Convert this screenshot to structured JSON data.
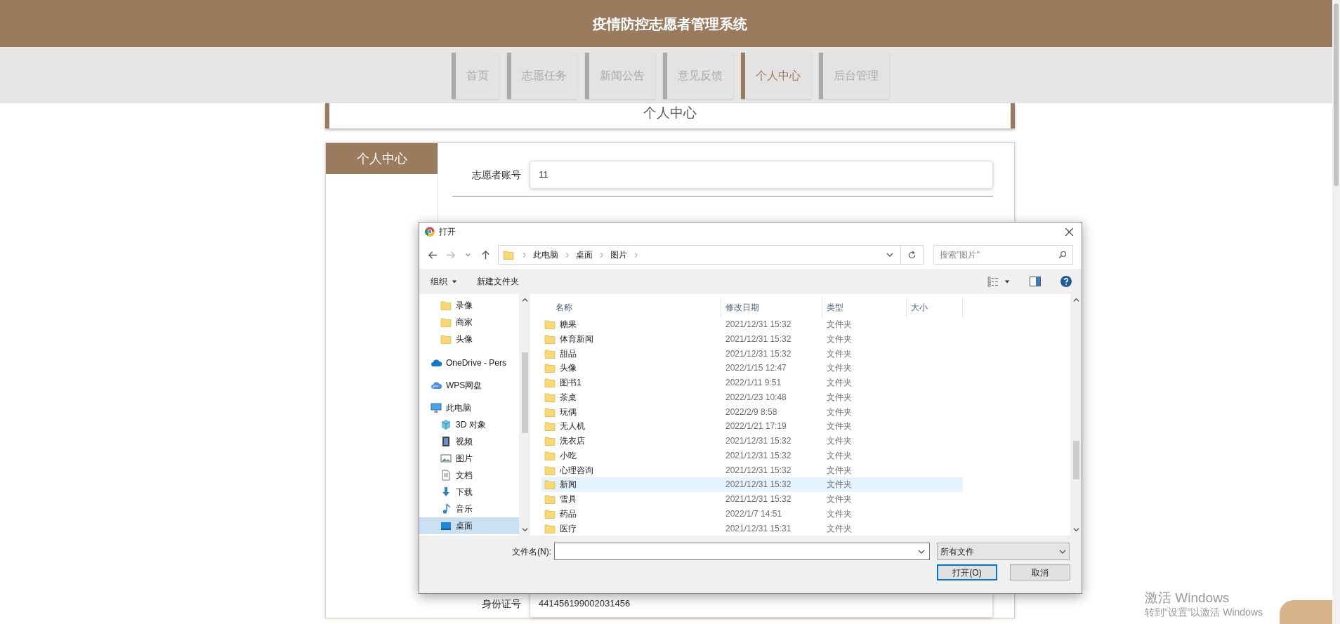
{
  "header": {
    "title": "疫情防控志愿者管理系统"
  },
  "nav": [
    {
      "label": "首页",
      "selected": false
    },
    {
      "label": "志愿任务",
      "selected": false
    },
    {
      "label": "新闻公告",
      "selected": false
    },
    {
      "label": "意见反馈",
      "selected": false
    },
    {
      "label": "个人中心",
      "selected": true
    },
    {
      "label": "后台管理",
      "selected": false
    }
  ],
  "page_title": "个人中心",
  "sidebar": {
    "title": "个人中心"
  },
  "form": {
    "fields": [
      {
        "label": "志愿者账号",
        "value": "11"
      },
      {
        "label": "身份证号",
        "value": "441456199002031456"
      }
    ]
  },
  "dialog": {
    "title": "打开",
    "breadcrumb": [
      "此电脑",
      "桌面",
      "图片"
    ],
    "search": {
      "placeholder": "搜索\"图片\""
    },
    "toolbar": {
      "organize": "组织",
      "new_folder": "新建文件夹"
    },
    "nav_pane": [
      {
        "label": "录像",
        "kind": "folder",
        "selected": false
      },
      {
        "label": "商家",
        "kind": "folder",
        "selected": false
      },
      {
        "label": "头像",
        "kind": "folder",
        "selected": false
      },
      {
        "label": "OneDrive - Pers",
        "kind": "onedrive",
        "selected": false
      },
      {
        "label": "WPS网盘",
        "kind": "cloud",
        "selected": false
      },
      {
        "label": "此电脑",
        "kind": "pc",
        "selected": false,
        "children": [
          {
            "label": "3D 对象",
            "kind": "cube",
            "selected": false
          },
          {
            "label": "视频",
            "kind": "video",
            "selected": false
          },
          {
            "label": "图片",
            "kind": "pictures",
            "selected": false
          },
          {
            "label": "文档",
            "kind": "document",
            "selected": false
          },
          {
            "label": "下载",
            "kind": "download",
            "selected": false
          },
          {
            "label": "音乐",
            "kind": "music",
            "selected": false
          },
          {
            "label": "桌面",
            "kind": "desktop",
            "selected": true
          }
        ]
      }
    ],
    "columns": [
      "名称",
      "修改日期",
      "类型",
      "大小"
    ],
    "files": [
      {
        "name": "糖果",
        "modified": "2021/12/31 15:32",
        "type": "文件夹",
        "hovered": false
      },
      {
        "name": "体育新闻",
        "modified": "2021/12/31 15:32",
        "type": "文件夹",
        "hovered": false
      },
      {
        "name": "甜品",
        "modified": "2021/12/31 15:32",
        "type": "文件夹",
        "hovered": false
      },
      {
        "name": "头像",
        "modified": "2022/1/15 12:47",
        "type": "文件夹",
        "hovered": false
      },
      {
        "name": "图书1",
        "modified": "2022/1/11 9:51",
        "type": "文件夹",
        "hovered": false
      },
      {
        "name": "茶桌",
        "modified": "2022/1/23 10:48",
        "type": "文件夹",
        "hovered": false
      },
      {
        "name": "玩偶",
        "modified": "2022/2/9 8:58",
        "type": "文件夹",
        "hovered": false
      },
      {
        "name": "无人机",
        "modified": "2022/1/21 17:19",
        "type": "文件夹",
        "hovered": false
      },
      {
        "name": "洗衣店",
        "modified": "2021/12/31 15:32",
        "type": "文件夹",
        "hovered": false
      },
      {
        "name": "小吃",
        "modified": "2021/12/31 15:32",
        "type": "文件夹",
        "hovered": false
      },
      {
        "name": "心理咨询",
        "modified": "2021/12/31 15:32",
        "type": "文件夹",
        "hovered": false
      },
      {
        "name": "新闻",
        "modified": "2021/12/31 15:32",
        "type": "文件夹",
        "hovered": true
      },
      {
        "name": "雪具",
        "modified": "2021/12/31 15:32",
        "type": "文件夹",
        "hovered": false
      },
      {
        "name": "药品",
        "modified": "2022/1/7 14:51",
        "type": "文件夹",
        "hovered": false
      },
      {
        "name": "医疗",
        "modified": "2021/12/31 15:31",
        "type": "文件夹",
        "hovered": false
      }
    ],
    "filename_label": "文件名(N):",
    "filter": "所有文件",
    "buttons": [
      {
        "label": "打开(O)",
        "default": true
      },
      {
        "label": "取消",
        "default": false
      }
    ]
  },
  "activation": {
    "title": "激活 Windows",
    "subtitle": "转到“设置”以激活 Windows"
  }
}
